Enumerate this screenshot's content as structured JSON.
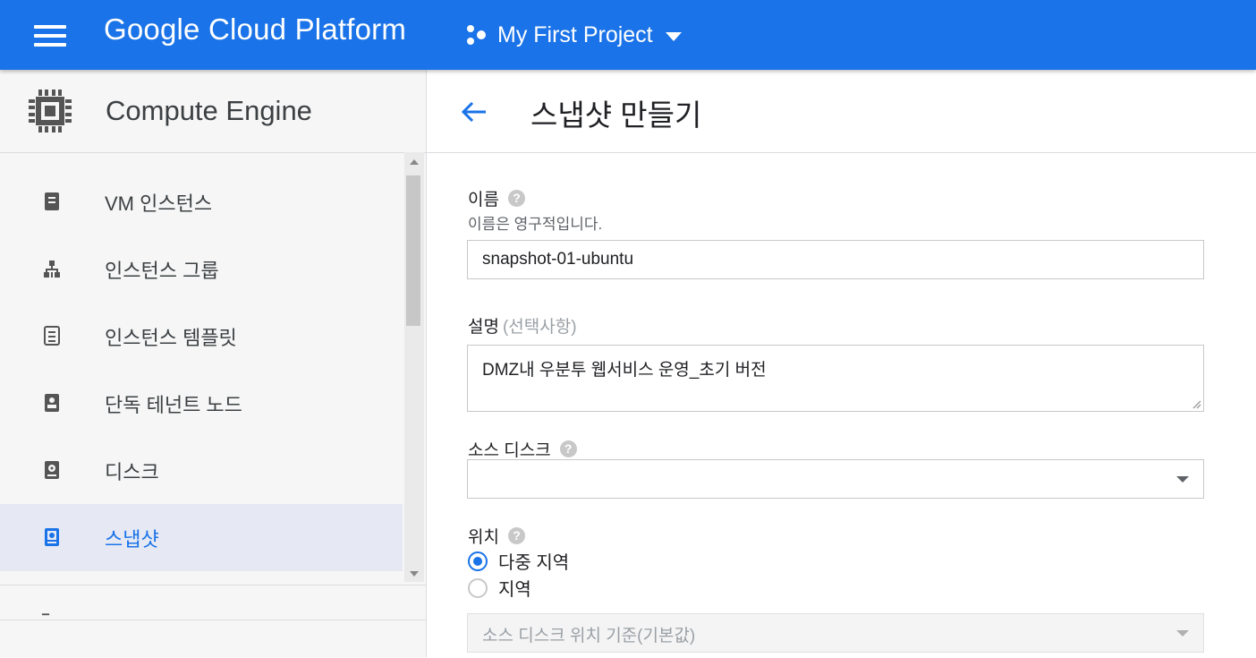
{
  "topbar": {
    "app_title": "Google Cloud Platform",
    "project_name": "My First Project",
    "color": "#1a73e8"
  },
  "sidebar": {
    "title": "Compute Engine",
    "items": [
      {
        "label": "VM 인스턴스",
        "icon": "vm-instance-icon",
        "active": false
      },
      {
        "label": "인스턴스 그룹",
        "icon": "instance-group-icon",
        "active": false
      },
      {
        "label": "인스턴스 템플릿",
        "icon": "instance-template-icon",
        "active": false
      },
      {
        "label": "단독 테넌트 노드",
        "icon": "sole-tenant-node-icon",
        "active": false
      },
      {
        "label": "디스크",
        "icon": "disk-icon",
        "active": false
      },
      {
        "label": "스냅샷",
        "icon": "snapshot-icon",
        "active": true
      }
    ],
    "active_color": "#1a73e8"
  },
  "main": {
    "page_title": "스냅샷 만들기",
    "name": {
      "label": "이름",
      "hint": "이름은 영구적입니다.",
      "value": "snapshot-01-ubuntu"
    },
    "description": {
      "label": "설명",
      "optional": "(선택사항)",
      "value": "DMZ내 우분투 웹서비스 운영_초기 버전"
    },
    "source_disk": {
      "label": "소스 디스크",
      "value": ""
    },
    "location": {
      "label": "위치",
      "options": [
        {
          "label": "다중 지역",
          "checked": true
        },
        {
          "label": "지역",
          "checked": false
        }
      ],
      "select_placeholder": "소스 디스크 위치 기준(기본값)"
    }
  }
}
